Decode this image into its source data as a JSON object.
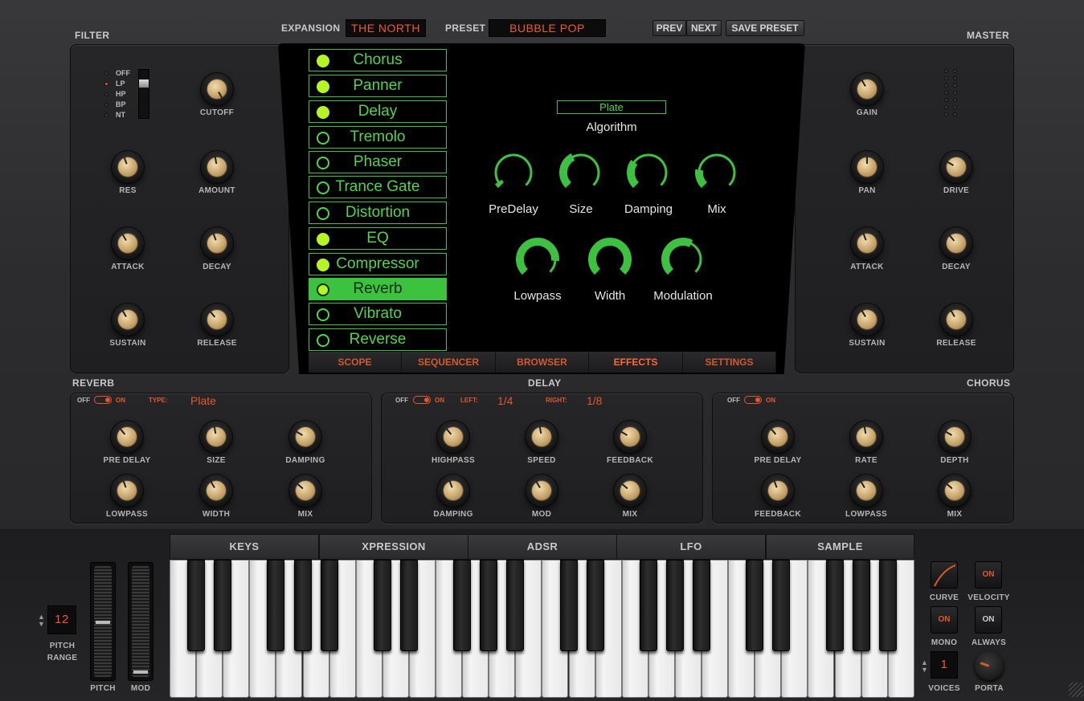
{
  "header": {
    "expansion_label": "EXPANSION",
    "expansion_value": "THE NORTH",
    "preset_label": "PRESET",
    "preset_value": "BUBBLE POP",
    "prev": "PREV",
    "next": "NEXT",
    "save": "SAVE PRESET"
  },
  "filter": {
    "title": "FILTER",
    "modes": [
      "OFF",
      "LP",
      "HP",
      "BP",
      "NT"
    ],
    "selected_mode": "LP",
    "knobs": [
      "CUTOFF",
      "RES",
      "AMOUNT",
      "ATTACK",
      "DECAY",
      "SUSTAIN",
      "RELEASE"
    ]
  },
  "master": {
    "title": "MASTER",
    "knobs": [
      "GAIN",
      "PAN",
      "DRIVE",
      "ATTACK",
      "DECAY",
      "SUSTAIN",
      "RELEASE"
    ]
  },
  "effects_list": [
    {
      "label": "Chorus",
      "on": true
    },
    {
      "label": "Panner",
      "on": true
    },
    {
      "label": "Delay",
      "on": true
    },
    {
      "label": "Tremolo",
      "on": false
    },
    {
      "label": "Phaser",
      "on": false
    },
    {
      "label": "Trance Gate",
      "on": false
    },
    {
      "label": "Distortion",
      "on": false
    },
    {
      "label": "EQ",
      "on": true
    },
    {
      "label": "Compressor",
      "on": true
    },
    {
      "label": "Reverb",
      "on": true,
      "selected": true
    },
    {
      "label": "Vibrato",
      "on": false
    },
    {
      "label": "Reverse",
      "on": false
    }
  ],
  "effect_editor": {
    "algorithm_value": "Plate",
    "algorithm_label": "Algorithm",
    "knobs": [
      {
        "label": "PreDelay",
        "value": 0.05
      },
      {
        "label": "Size",
        "value": 0.4
      },
      {
        "label": "Damping",
        "value": 0.3
      },
      {
        "label": "Mix",
        "value": 0.2
      },
      {
        "label": "Lowpass",
        "value": 0.85
      },
      {
        "label": "Width",
        "value": 1.0
      },
      {
        "label": "Modulation",
        "value": 0.6
      }
    ]
  },
  "screen_tabs": [
    "SCOPE",
    "SEQUENCER",
    "BROWSER",
    "EFFECTS",
    "SETTINGS"
  ],
  "active_tab": "EFFECTS",
  "reverb": {
    "title": "REVERB",
    "off": "OFF",
    "on": "ON",
    "type_label": "TYPE:",
    "type_value": "Plate",
    "knobs": [
      "PRE DELAY",
      "SIZE",
      "DAMPING",
      "LOWPASS",
      "WIDTH",
      "MIX"
    ]
  },
  "delay": {
    "title": "DELAY",
    "off": "OFF",
    "on": "ON",
    "left_label": "LEFT:",
    "left_value": "1/4",
    "right_label": "RIGHT:",
    "right_value": "1/8",
    "knobs": [
      "HIGHPASS",
      "SPEED",
      "FEEDBACK",
      "DAMPING",
      "MOD",
      "MIX"
    ]
  },
  "chorus": {
    "title": "CHORUS",
    "off": "OFF",
    "on": "ON",
    "knobs": [
      "PRE DELAY",
      "RATE",
      "DEPTH",
      "FEEDBACK",
      "LOWPASS",
      "MIX"
    ]
  },
  "keyboard_tabs": [
    "KEYS",
    "XPRESSION",
    "ADSR",
    "LFO",
    "SAMPLE"
  ],
  "left_controls": {
    "pitch_range_value": "12",
    "pitch_range_label": "PITCH\nRANGE",
    "pitch_label": "PITCH",
    "mod_label": "MOD"
  },
  "right_controls": {
    "curve": "CURVE",
    "velocity_btn": "ON",
    "velocity": "VELOCITY",
    "mono_btn": "ON",
    "mono": "MONO",
    "always_btn": "ON",
    "always": "ALWAYS",
    "voices_value": "1",
    "voices": "VOICES",
    "porta": "PORTA"
  },
  "colors": {
    "accent": "#e0582a",
    "screen_green": "#3ec040",
    "led_green": "#b6f425",
    "knob_gold": "#c9a66d"
  }
}
